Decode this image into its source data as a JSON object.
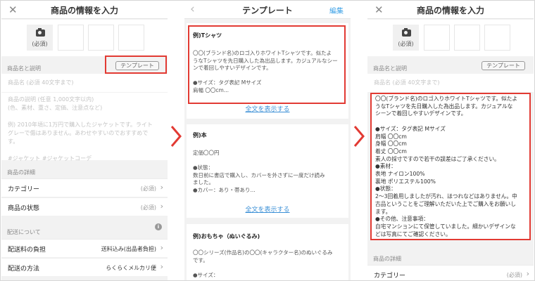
{
  "panel1": {
    "title": "商品の情報を入力",
    "photo_required": "(必須)",
    "section_name_desc": "商品名と説明",
    "template_button": "テンプレート",
    "name_placeholder": "商品名 (必須 40文字まで)",
    "desc_placeholder": [
      "商品の説明 (任意 1,000文字以内)",
      "(色、素材、重さ、定価、注意点など)",
      "",
      "例) 2010年頃に1万円で購入したジャケットです。ライト",
      "グレーで傷はありません。あわせやすいのでおすすめで",
      "す。",
      "",
      "#ジャケット #ジャケットコーデ"
    ],
    "section_details": "商品の詳細",
    "category_label": "カテゴリー",
    "category_value": "(必須)",
    "condition_label": "商品の状態",
    "condition_value": "(必須)",
    "section_shipping": "配送について",
    "shipping_fee_label": "配送料の負担",
    "shipping_fee_value": "送料込み(出品者負担)",
    "shipping_method_label": "配送の方法",
    "shipping_method_value": "らくらくメルカリ便"
  },
  "panel2": {
    "title": "テンプレート",
    "edit_label": "編集",
    "show_all": "全文を表示する",
    "cards": [
      {
        "title": "例)Tシャツ",
        "body": [
          "〇〇(ブランド名)のロゴ入りホワイトTシャツです。似たよ",
          "うなTシャツを先日購入した為出品します。カジュアルなシー",
          "ンで着回しやすいデザインです。",
          "",
          "●サイズ：タグ表記 Mサイズ",
          "肩幅 〇〇cm..."
        ]
      },
      {
        "title": "例)本",
        "body": [
          "定価〇〇円",
          "",
          "●状態：",
          "数日前に書店で購入し、カバーを外さずに一度だけ読み",
          "ました。",
          "●カバー：あり・帯あり..."
        ]
      },
      {
        "title": "例)おもちゃ（ぬいぐるみ)",
        "body": [
          "〇〇シリーズ(作品名)の〇〇(キャラクター名)のぬいぐるみ",
          "です。",
          "",
          "●サイズ："
        ]
      }
    ]
  },
  "panel3": {
    "title": "商品の情報を入力",
    "photo_required": "(必須)",
    "section_name_desc": "商品名と説明",
    "template_button": "テンプレート",
    "name_placeholder": "商品名 (必須 40文字まで)",
    "description_lines": [
      "〇〇(ブランド名)のロゴ入りホワイトTシャツです。似たよ",
      "うなTシャツを先日購入した為出品します。カジュアルな",
      "シーンで着回しやすいデザインです。",
      "",
      "●サイズ：タグ表記 Mサイズ",
      "肩幅 〇〇cm",
      "身幅 〇〇cm",
      "着丈 〇〇cm",
      "素人の採寸ですので若干の誤差はご了承ください。",
      "●素材：",
      "表地 ナイロン100%",
      "裏地 ポリエステル100%",
      "●状態：",
      "2〜3回着用しましたが汚れ、ほつれなどはありません。中",
      "古品ということをご理解いただいた上でご購入をお願いし",
      "ます。",
      "●その他、注意事項：",
      "自宅マンションにて保管していました。細かいデザインな",
      "どは写真にてご確認ください。"
    ],
    "section_details": "商品の詳細",
    "category_label": "カテゴリー",
    "category_value": "(必須)"
  },
  "colors": {
    "highlight": "#e23a33",
    "link": "#3a8fd6",
    "accent": "#3aa0e6"
  }
}
